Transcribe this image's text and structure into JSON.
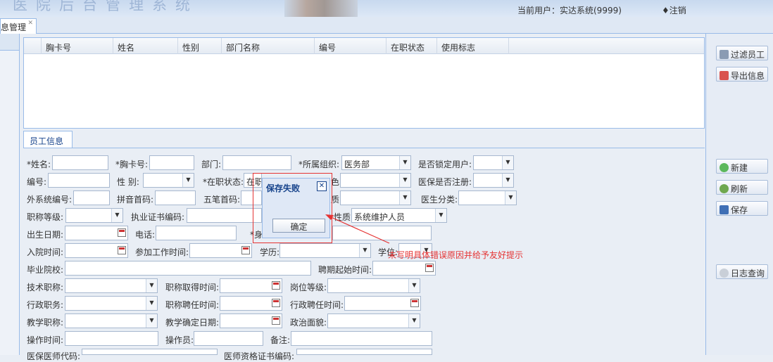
{
  "header": {
    "system_title": "医院后台管理系统",
    "current_user": "当前用户：实达系统(9999)",
    "logout": "♦注销"
  },
  "tabs": [
    {
      "label": "息管理"
    }
  ],
  "grid": {
    "columns": [
      "胸卡号",
      "姓名",
      "性别",
      "部门名称",
      "编号",
      "在职状态",
      "使用标志"
    ]
  },
  "right_buttons": {
    "filter": "过滤员工",
    "export": "导出信息",
    "new": "新建",
    "refresh": "刷新",
    "save": "保存",
    "log": "日志查询"
  },
  "emp_panel": {
    "tab": "员工信息"
  },
  "form": {
    "name": "*姓名:",
    "card_no": "*胸卡号:",
    "dept": "部门:",
    "org": "*所属组织:",
    "org_value": "医务部",
    "locked": "是否锁定用户:",
    "code": "编号:",
    "gender": "性 别:",
    "status": "*在职状态:",
    "status_value": "在职",
    "role_partial": "色:",
    "insurance_reg": "医保是否注册:",
    "ext_code": "外系统编号:",
    "pinyin": "拼音首码:",
    "wubi": "五笔首码:",
    "partial_field": "质:",
    "doctor_type": "医生分类:",
    "title_level": "职称等级:",
    "license_code": "执业证书编码:",
    "nature_partial": "性质:",
    "nature_value": "系统维护人员",
    "birthday": "出生日期:",
    "phone": "电话:",
    "id_partial": "*身",
    "admit_time": "入院时间:",
    "work_start": "参加工作时间:",
    "education": "学历:",
    "degree": "学位:",
    "school": "毕业院校:",
    "hire_start": "聘期起始时间:",
    "tech_title": "技术职称:",
    "title_obtain": "职称取得时间:",
    "post_level": "岗位等级:",
    "admin_post": "行政职务:",
    "title_hire": "职称聘任时间:",
    "admin_hire": "行政聘任时间:",
    "teach_title": "教学职称:",
    "teach_confirm": "教学确定日期:",
    "political": "政治面貌:",
    "op_time": "操作时间:",
    "operator": "操作员:",
    "remark": "备注:",
    "insurance_doc": "医保医师代码:",
    "doc_cert": "医师资格证书编码:"
  },
  "dialog": {
    "title": "保存失败",
    "close": "✕",
    "ok": "确定"
  },
  "annotation": "未写明具体错误原因并给予友好提示",
  "colors": {
    "annotation_red": "#e53333",
    "accent_blue": "#15428b",
    "border_blue": "#99bbe8"
  }
}
